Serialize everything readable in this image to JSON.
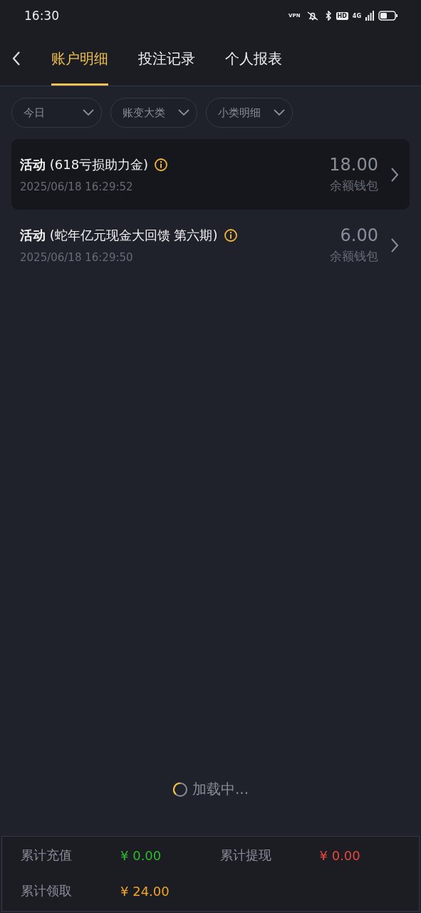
{
  "status_bar": {
    "time": "16:30",
    "vpn": "VPN",
    "hd": "HD",
    "network": "4G"
  },
  "tabs": [
    {
      "label": "账户明细",
      "selected": true
    },
    {
      "label": "投注记录",
      "selected": false
    },
    {
      "label": "个人报表",
      "selected": false
    }
  ],
  "filters": [
    {
      "label": "今日"
    },
    {
      "label": "账变大类"
    },
    {
      "label": "小类明细"
    }
  ],
  "records": [
    {
      "type": "活动",
      "title": "(618亏损助力金)",
      "time": "2025/06/18 16:29:52",
      "amount": "18.00",
      "wallet": "余额钱包",
      "selected": true
    },
    {
      "type": "活动",
      "title": "(蛇年亿元现金大回馈 第六期)",
      "time": "2025/06/18 16:29:50",
      "amount": "6.00",
      "wallet": "余额钱包",
      "selected": false
    }
  ],
  "loading": "加载中...",
  "totals": [
    {
      "label": "累计充值",
      "value": "¥ 0.00",
      "color": "#2dba2d"
    },
    {
      "label": "累计提现",
      "value": "¥ 0.00",
      "color": "#e8473f"
    },
    {
      "label": "累计领取",
      "value": "¥ 24.00",
      "color": "#f0a52a"
    }
  ]
}
